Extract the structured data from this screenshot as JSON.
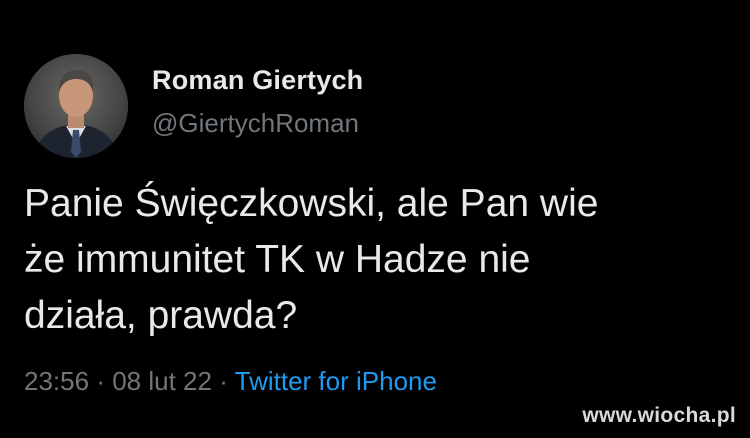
{
  "author": {
    "display_name": "Roman Giertych",
    "handle": "@GiertychRoman"
  },
  "tweet": {
    "text": "Panie Święczkowski, ale Pan wie\nże immunitet TK w Hadze nie\ndziała, prawda?",
    "time": "23:56",
    "separator": "·",
    "date": "08 lut 22",
    "source": "Twitter for iPhone"
  },
  "watermark": "www.wiocha.pl",
  "colors": {
    "background": "#000000",
    "primary_text": "#e7e9ea",
    "secondary_text": "#71767b",
    "link": "#1d9bf0"
  }
}
